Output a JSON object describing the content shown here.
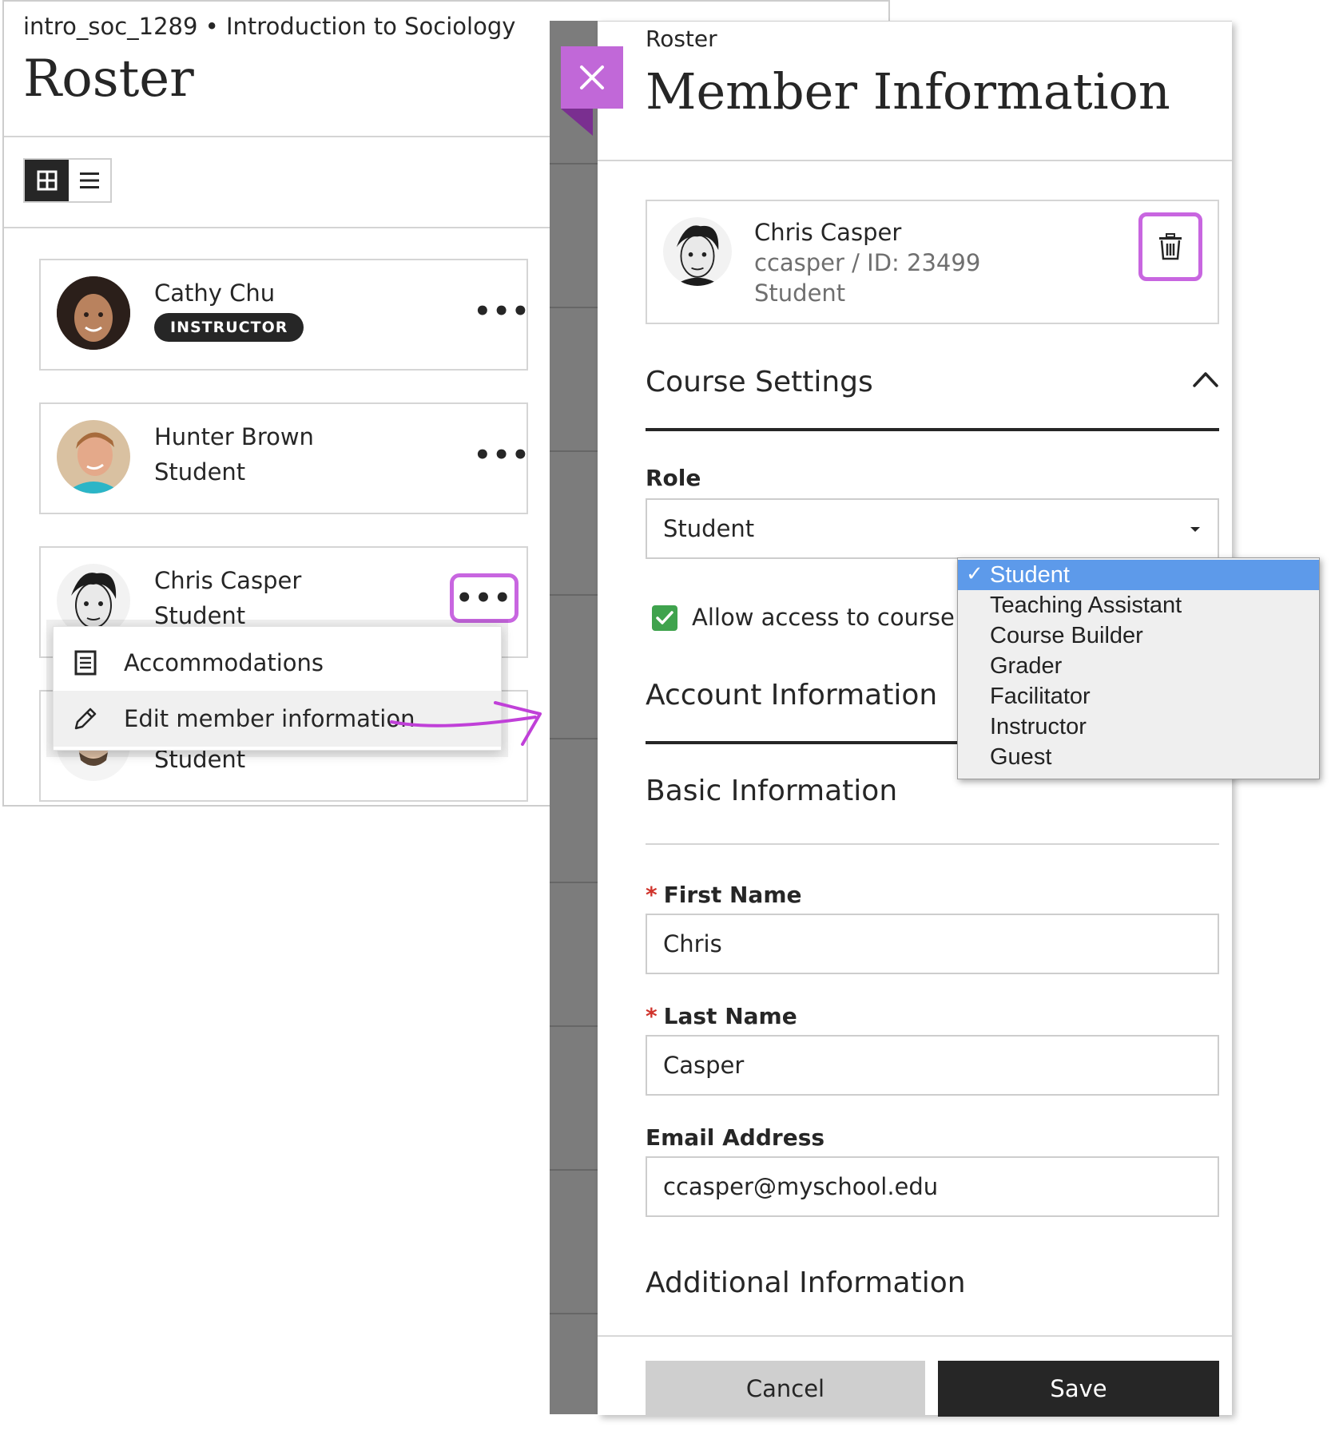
{
  "roster": {
    "course_line": "intro_soc_1289 • Introduction to Sociology",
    "title": "Roster",
    "members": [
      {
        "name": "Cathy Chu",
        "role": "INSTRUCTOR"
      },
      {
        "name": "Hunter Brown",
        "role": "Student"
      },
      {
        "name": "Chris Casper",
        "role": "Student"
      },
      {
        "name": "",
        "role": "Student"
      }
    ],
    "more_label": "•••",
    "context_menu": {
      "items": [
        {
          "label": "Accommodations",
          "icon": "document-list-icon"
        },
        {
          "label": "Edit member information",
          "icon": "pencil-icon"
        }
      ]
    }
  },
  "panel": {
    "breadcrumb": "Roster",
    "title": "Member Information",
    "member": {
      "name": "Chris Casper",
      "username_id": "ccasper / ID: 23499",
      "role": "Student"
    },
    "course_settings": {
      "heading": "Course Settings",
      "role_label": "Role",
      "role_value": "Student",
      "role_options": [
        "Student",
        "Teaching Assistant",
        "Course Builder",
        "Grader",
        "Facilitator",
        "Instructor",
        "Guest"
      ],
      "allow_access_label": "Allow access to course",
      "allow_access_checked": true
    },
    "account_information": {
      "heading": "Account Information",
      "basic_heading": "Basic Information",
      "required_mark": "*",
      "first_name_label": "First Name",
      "first_name_value": "Chris",
      "last_name_label": "Last Name",
      "last_name_value": "Casper",
      "email_label": "Email Address",
      "email_value": "ccasper@myschool.edu",
      "additional_heading": "Additional Information"
    },
    "buttons": {
      "cancel": "Cancel",
      "save": "Save"
    }
  },
  "colors": {
    "accent": "#c866e0",
    "dark": "#262626",
    "select_highlight": "#5d9aea",
    "check_green": "#3fa34d",
    "required": "#d0342c"
  }
}
